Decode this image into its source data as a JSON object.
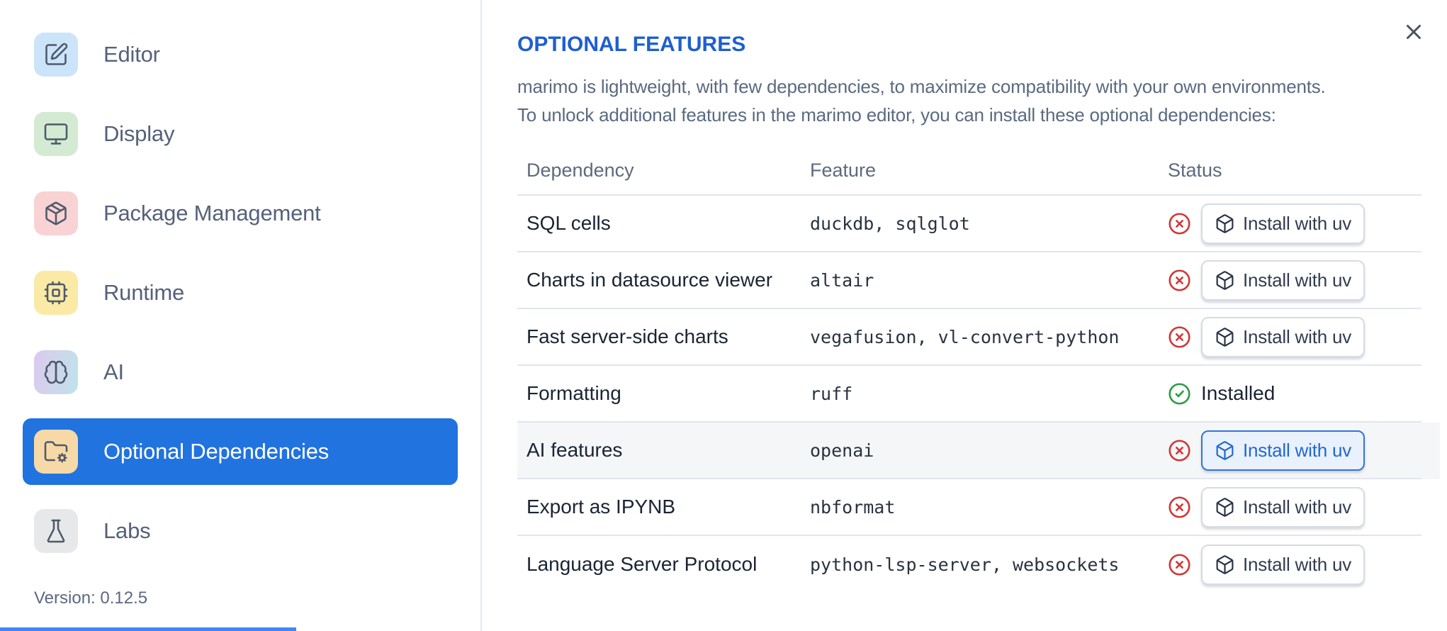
{
  "colors": {
    "accent_blue": "#2173df",
    "heading_blue": "#1e5fd0",
    "error_red": "#d23737",
    "success_green": "#2d9c46",
    "highlight_row_bg": "#f5f6f8",
    "focused_button_border": "#3274db"
  },
  "sidebar": {
    "items": [
      {
        "label": "Editor",
        "icon": "square-pen-icon",
        "tile_color": "#cbe4f9"
      },
      {
        "label": "Display",
        "icon": "monitor-icon",
        "tile_color": "#d4ead2"
      },
      {
        "label": "Package Management",
        "icon": "package-icon",
        "tile_color": "#f9d2d3"
      },
      {
        "label": "Runtime",
        "icon": "cpu-icon",
        "tile_color": "#fbeaa6"
      },
      {
        "label": "AI",
        "icon": "brain-icon",
        "tile_color": "linear-gradient(100deg,#dcc9ee,#bfe3ea)"
      },
      {
        "label": "Optional Dependencies",
        "icon": "folder-cog-icon",
        "tile_color": "#f7d9a7",
        "selected": true
      },
      {
        "label": "Labs",
        "icon": "flask-icon",
        "tile_color": "#e7e8e9"
      }
    ],
    "version_label": "Version: 0.12.5"
  },
  "panel": {
    "title": "OPTIONAL FEATURES",
    "description_line1": "marimo is lightweight, with few dependencies, to maximize compatibility with your own environments.",
    "description_line2": "To unlock additional features in the marimo editor, you can install these optional dependencies:",
    "table": {
      "columns": [
        "Dependency",
        "Feature",
        "Status"
      ],
      "rows": [
        {
          "dependency": "SQL cells",
          "feature": "duckdb, sqlglot",
          "status": "missing",
          "action": "Install with uv"
        },
        {
          "dependency": "Charts in datasource viewer",
          "feature": "altair",
          "status": "missing",
          "action": "Install with uv"
        },
        {
          "dependency": "Fast server-side charts",
          "feature": "vegafusion, vl-convert-python",
          "status": "missing",
          "action": "Install with uv"
        },
        {
          "dependency": "Formatting",
          "feature": "ruff",
          "status": "installed",
          "status_label": "Installed"
        },
        {
          "dependency": "AI features",
          "feature": "openai",
          "status": "missing",
          "action": "Install with uv",
          "highlighted": true,
          "action_focused": true
        },
        {
          "dependency": "Export as IPYNB",
          "feature": "nbformat",
          "status": "missing",
          "action": "Install with uv"
        },
        {
          "dependency": "Language Server Protocol",
          "feature": "python-lsp-server, websockets",
          "status": "missing",
          "action": "Install with uv"
        }
      ]
    }
  }
}
